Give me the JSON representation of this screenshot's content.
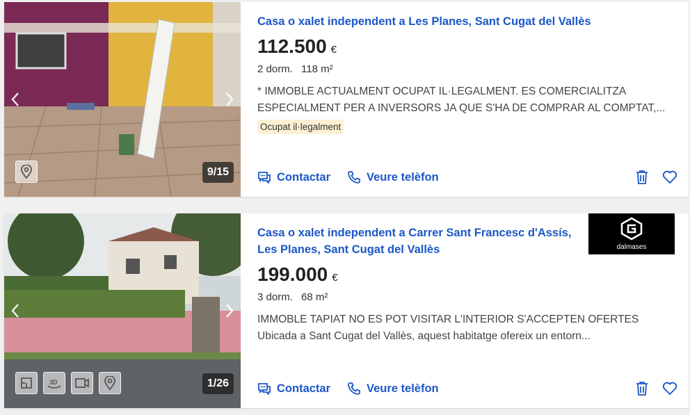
{
  "listings": [
    {
      "title": "Casa o xalet independent a Les Planes, Sant Cugat del Vallès",
      "price": "112.500",
      "currency": "€",
      "rooms": "2 dorm.",
      "area": "118 m²",
      "description_lines": [
        "* IMMOBLE ACTUALMENT OCUPAT IL·LEGALMENT. ES COMERCIALITZA",
        "ESPECIALMENT PER A INVERSORS JA QUE S'HA DE COMPRAR AL COMPTAT,..."
      ],
      "tag": "Ocupat il·legalment",
      "photo_counter": "9/15",
      "contact_label": "Contactar",
      "phone_label": "Veure telèfon"
    },
    {
      "title_line1": "Casa o xalet independent a Carrer Sant Francesc d'Assís,",
      "title_line2": "Les Planes, Sant Cugat del Vallès",
      "price": "199.000",
      "currency": "€",
      "rooms": "3 dorm.",
      "area": "68 m²",
      "description_lines": [
        "IMMOBLE TAPIAT NO ES POT VISITAR L'INTERIOR S'ACCEPTEN OFERTES",
        "Ubicada a Sant Cugat del Vallès, aquest habitatge ofereix un entorn..."
      ],
      "photo_counter": "1/26",
      "agency_logo_text": "dalmases",
      "contact_label": "Contactar",
      "phone_label": "Veure telèfon"
    }
  ],
  "colors": {
    "link_blue": "#1b57c7",
    "tag_bg": "#fdf1d4",
    "price_text": "#222222"
  },
  "icons": [
    "chevron-left-icon",
    "chevron-right-icon",
    "map-pin-icon",
    "floorplan-icon",
    "3d-icon",
    "video-icon",
    "chat-icon",
    "phone-icon",
    "trash-icon",
    "heart-icon"
  ]
}
